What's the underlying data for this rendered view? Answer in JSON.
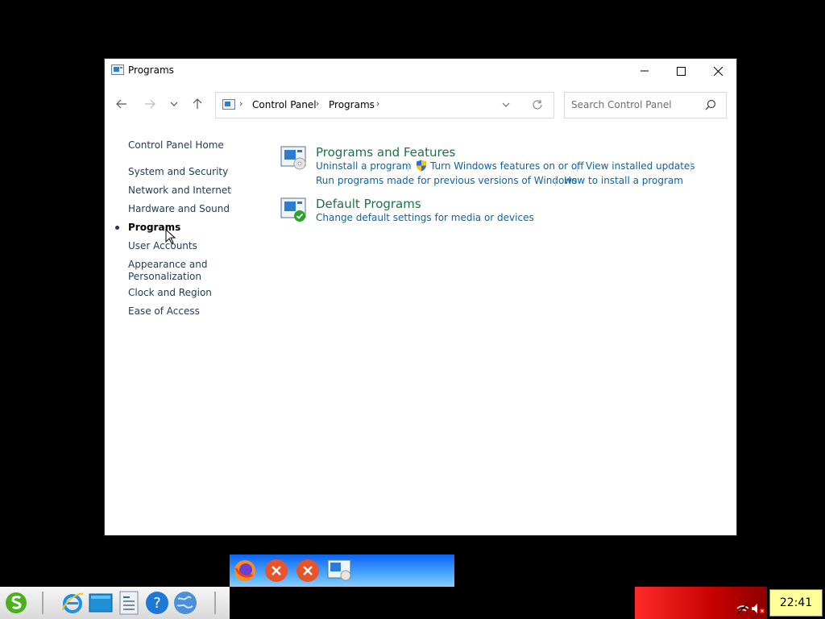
{
  "window": {
    "title": "Programs",
    "icon": "control-panel-icon"
  },
  "address": {
    "crumbs": [
      "Control Panel",
      "Programs"
    ]
  },
  "search": {
    "placeholder": "Search Control Panel",
    "value": ""
  },
  "sidebar": {
    "items": [
      {
        "label": "Control Panel Home"
      },
      {
        "label": "System and Security"
      },
      {
        "label": "Network and Internet"
      },
      {
        "label": "Hardware and Sound"
      },
      {
        "label": "Programs",
        "active": true
      },
      {
        "label": "User Accounts"
      },
      {
        "label": "Appearance and"
      },
      {
        "label": "Personalization"
      },
      {
        "label": "Clock and Region"
      },
      {
        "label": "Ease of Access"
      }
    ]
  },
  "categories": [
    {
      "title": "Programs and Features",
      "icon": "programs-features-icon",
      "links": [
        "Uninstall a program",
        "Turn Windows features on or off",
        "View installed updates",
        "Run programs made for previous versions of Windows",
        "How to install a program"
      ]
    },
    {
      "title": "Default Programs",
      "icon": "default-programs-icon",
      "links": [
        "Change default settings for media or devices"
      ]
    }
  ],
  "taskbar": {
    "clock": "22:41",
    "launchers": [
      "start-icon",
      "internet-explorer-icon",
      "desktop-icon",
      "document-icon",
      "help-icon",
      "globe-icon"
    ],
    "popup_items": [
      "firefox-icon",
      "error-icon",
      "error-icon",
      "control-panel-icon"
    ],
    "tray": [
      "network-disconnected-icon",
      "volume-muted-icon"
    ]
  },
  "colors": {
    "link": "#0b63a8",
    "category_title": "#1e7145",
    "sidebar_text": "#1e3a56",
    "clock_bg": "#ffff99",
    "tray_bg": "#c60000"
  }
}
